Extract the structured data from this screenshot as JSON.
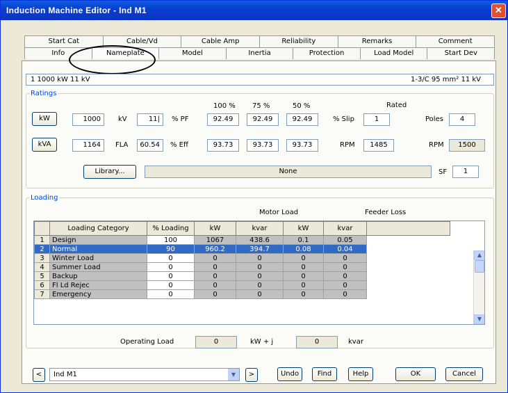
{
  "window": {
    "title": "Induction Machine Editor - Ind M1",
    "close": "✕"
  },
  "tabs": {
    "row1": [
      "Start Cat",
      "Cable/Vd",
      "Cable Amp",
      "Reliability",
      "Remarks",
      "Comment"
    ],
    "row2": [
      "Info",
      "Nameplate",
      "Model",
      "Inertia",
      "Protection",
      "Load Model",
      "Start Dev"
    ],
    "active": "Nameplate"
  },
  "infobar": {
    "left": "1   1000 kW   11 kV",
    "right": "1-3/C   95 mm²   11 kV"
  },
  "ratings": {
    "legend": "Ratings",
    "kw_button": "kW",
    "kva_button": "kVA",
    "kw_value": "1000",
    "kva_value": "1164",
    "kv_label": "kV",
    "kv_value": "11|",
    "fla_label": "FLA",
    "fla_value": "60.54",
    "pf_label": "% PF",
    "eff_label": "% Eff",
    "col_100": "100 %",
    "col_75": "75 %",
    "col_50": "50 %",
    "pf_100": "92.49",
    "pf_75": "92.49",
    "pf_50": "92.49",
    "eff_100": "93.73",
    "eff_75": "93.73",
    "eff_50": "93.73",
    "rated_label": "Rated",
    "slip_label": "% Slip",
    "slip_value": "1",
    "rpm_label": "RPM",
    "rpm_value": "1485",
    "poles_label": "Poles",
    "poles_value": "4",
    "rpm_sync_label": "RPM",
    "rpm_sync_value": "1500",
    "library_button": "Library...",
    "library_value": "None",
    "sf_label": "SF",
    "sf_value": "1"
  },
  "loading": {
    "legend": "Loading",
    "motor_load_label": "Motor Load",
    "feeder_loss_label": "Feeder Loss",
    "columns": [
      "Loading Category",
      "% Loading",
      "kW",
      "kvar",
      "kW",
      "kvar"
    ],
    "rows": [
      {
        "n": "1",
        "cat": "Design",
        "pl": "100",
        "kw": "1067",
        "kvar": "438.6",
        "fkw": "0.1",
        "fkvar": "0.05"
      },
      {
        "n": "2",
        "cat": "Normal",
        "pl": "90",
        "kw": "960.2",
        "kvar": "394.7",
        "fkw": "0.08",
        "fkvar": "0.04"
      },
      {
        "n": "3",
        "cat": "Winter Load",
        "pl": "0",
        "kw": "0",
        "kvar": "0",
        "fkw": "0",
        "fkvar": "0"
      },
      {
        "n": "4",
        "cat": "Summer Load",
        "pl": "0",
        "kw": "0",
        "kvar": "0",
        "fkw": "0",
        "fkvar": "0"
      },
      {
        "n": "5",
        "cat": "Backup",
        "pl": "0",
        "kw": "0",
        "kvar": "0",
        "fkw": "0",
        "fkvar": "0"
      },
      {
        "n": "6",
        "cat": "Fl Ld Rejec",
        "pl": "0",
        "kw": "0",
        "kvar": "0",
        "fkw": "0",
        "fkvar": "0"
      },
      {
        "n": "7",
        "cat": "Emergency",
        "pl": "0",
        "kw": "0",
        "kvar": "0",
        "fkw": "0",
        "fkvar": "0"
      }
    ],
    "selected_row": 1,
    "operating_load_label": "Operating Load",
    "op_kw": "0",
    "kw_j_label": "kW  + j",
    "op_kvar": "0",
    "kvar_label": "kvar"
  },
  "footer": {
    "prev": "<",
    "next": ">",
    "combo_value": "Ind M1",
    "undo": "Undo",
    "find": "Find",
    "help": "Help",
    "ok": "OK",
    "cancel": "Cancel"
  },
  "icons": {
    "dropdown": "chevron-down-icon",
    "scroll_up": "chevron-up-icon",
    "scroll_down": "chevron-down-icon"
  }
}
